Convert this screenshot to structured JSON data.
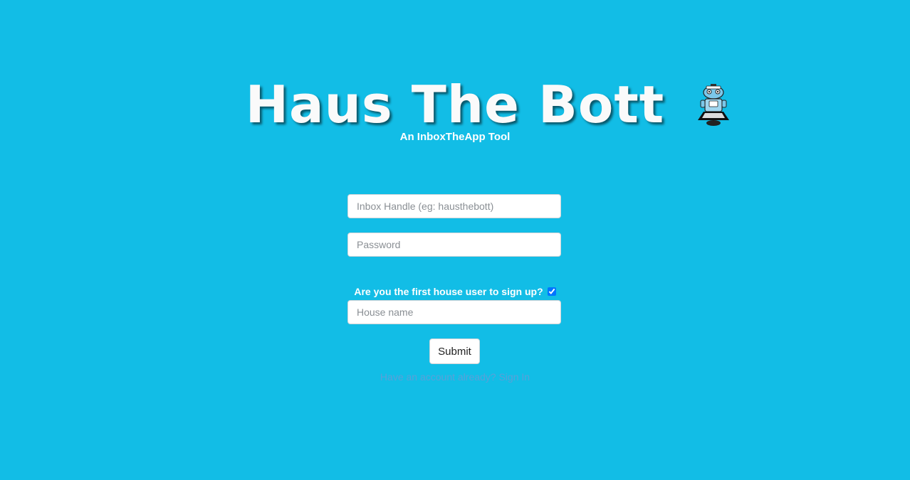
{
  "header": {
    "title": "Haus The Bott",
    "subtitle": "An InboxTheApp Tool",
    "mascot_icon": "robot-maid-icon"
  },
  "form": {
    "handle_placeholder": "Inbox Handle (eg: hausthebott)",
    "password_placeholder": "Password",
    "first_user_question": "Are you the first house user to sign up?",
    "first_user_checked": true,
    "house_name_placeholder": "House name",
    "submit_label": "Submit",
    "signin_link": "Have an account already? Sign In"
  },
  "colors": {
    "background": "#12bde6",
    "title": "#fafafa",
    "link": "#5aa0d8"
  }
}
